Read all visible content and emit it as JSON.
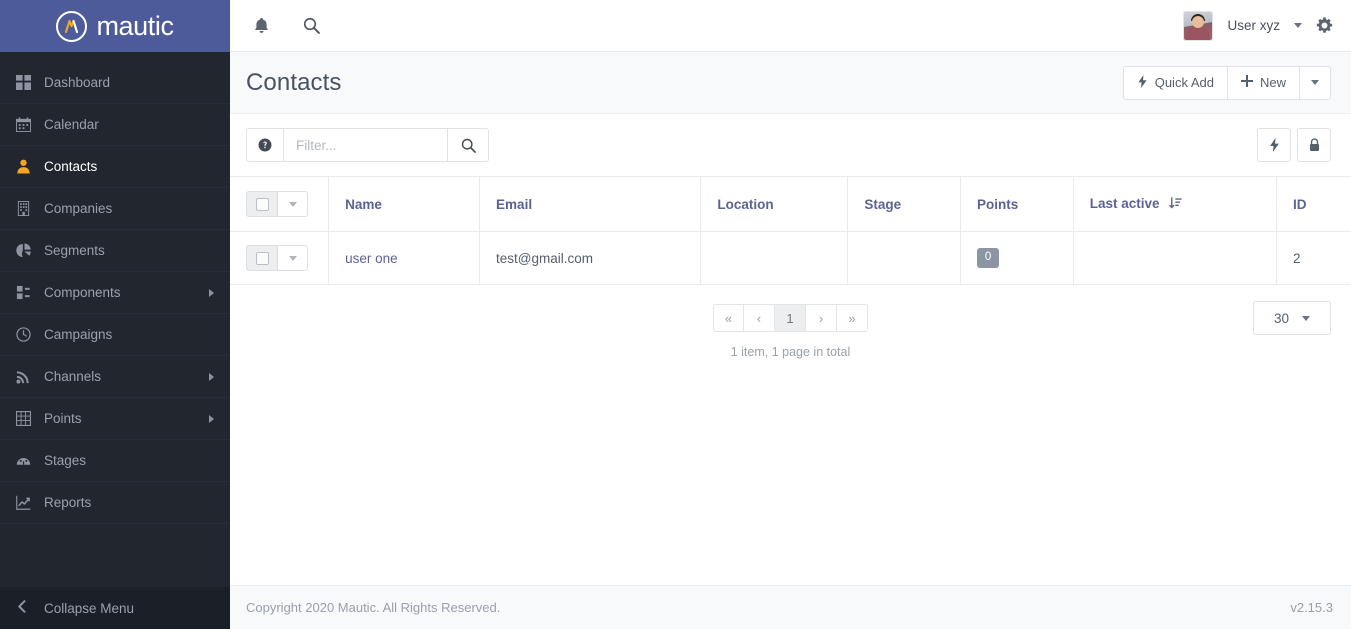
{
  "brand": {
    "name": "mautic",
    "mark_letter": "M"
  },
  "sidebar": {
    "items": [
      {
        "label": "Dashboard",
        "icon": "dashboard-icon",
        "active": false,
        "submenu": false
      },
      {
        "label": "Calendar",
        "icon": "calendar-icon",
        "active": false,
        "submenu": false
      },
      {
        "label": "Contacts",
        "icon": "contacts-icon",
        "active": true,
        "submenu": false
      },
      {
        "label": "Companies",
        "icon": "companies-icon",
        "active": false,
        "submenu": false
      },
      {
        "label": "Segments",
        "icon": "segments-icon",
        "active": false,
        "submenu": false
      },
      {
        "label": "Components",
        "icon": "components-icon",
        "active": false,
        "submenu": true
      },
      {
        "label": "Campaigns",
        "icon": "campaigns-icon",
        "active": false,
        "submenu": false
      },
      {
        "label": "Channels",
        "icon": "channels-icon",
        "active": false,
        "submenu": true
      },
      {
        "label": "Points",
        "icon": "points-icon",
        "active": false,
        "submenu": true
      },
      {
        "label": "Stages",
        "icon": "stages-icon",
        "active": false,
        "submenu": false
      },
      {
        "label": "Reports",
        "icon": "reports-icon",
        "active": false,
        "submenu": false
      }
    ],
    "collapse_label": "Collapse Menu"
  },
  "topbar": {
    "notifications_icon": "bell-icon",
    "search_icon": "search-icon",
    "user_name": "User xyz",
    "settings_icon": "gear-icon"
  },
  "page": {
    "title": "Contacts",
    "quick_add_label": "Quick Add",
    "new_label": "New"
  },
  "toolbar": {
    "help_icon": "question-circle-icon",
    "filter_placeholder": "Filter...",
    "filter_value": "",
    "search_icon": "search-icon",
    "lightning_icon": "lightning-icon",
    "lock_icon": "lock-icon"
  },
  "table": {
    "columns": [
      {
        "key": "check",
        "label": ""
      },
      {
        "key": "name",
        "label": "Name"
      },
      {
        "key": "email",
        "label": "Email"
      },
      {
        "key": "location",
        "label": "Location"
      },
      {
        "key": "stage",
        "label": "Stage"
      },
      {
        "key": "points",
        "label": "Points"
      },
      {
        "key": "lastactive",
        "label": "Last active",
        "sorted": "desc"
      },
      {
        "key": "id",
        "label": "ID"
      }
    ],
    "rows": [
      {
        "name": "user one",
        "email": "test@gmail.com",
        "location": "",
        "stage": "",
        "points": "0",
        "lastactive": "",
        "id": "2"
      }
    ]
  },
  "pagination": {
    "first_label": "«",
    "prev_label": "‹",
    "current_page": "1",
    "next_label": "›",
    "last_label": "»",
    "summary": "1 item, 1 page in total",
    "per_page": "30"
  },
  "footer": {
    "copyright": "Copyright 2020 Mautic. All Rights Reserved.",
    "version": "v2.15.3"
  },
  "colors": {
    "brand_bar": "#4e5b9b",
    "sidebar_bg": "#22262f",
    "active_icon": "#f5a623",
    "header_text": "#5b6394",
    "badge_bg": "#8d95a5"
  }
}
